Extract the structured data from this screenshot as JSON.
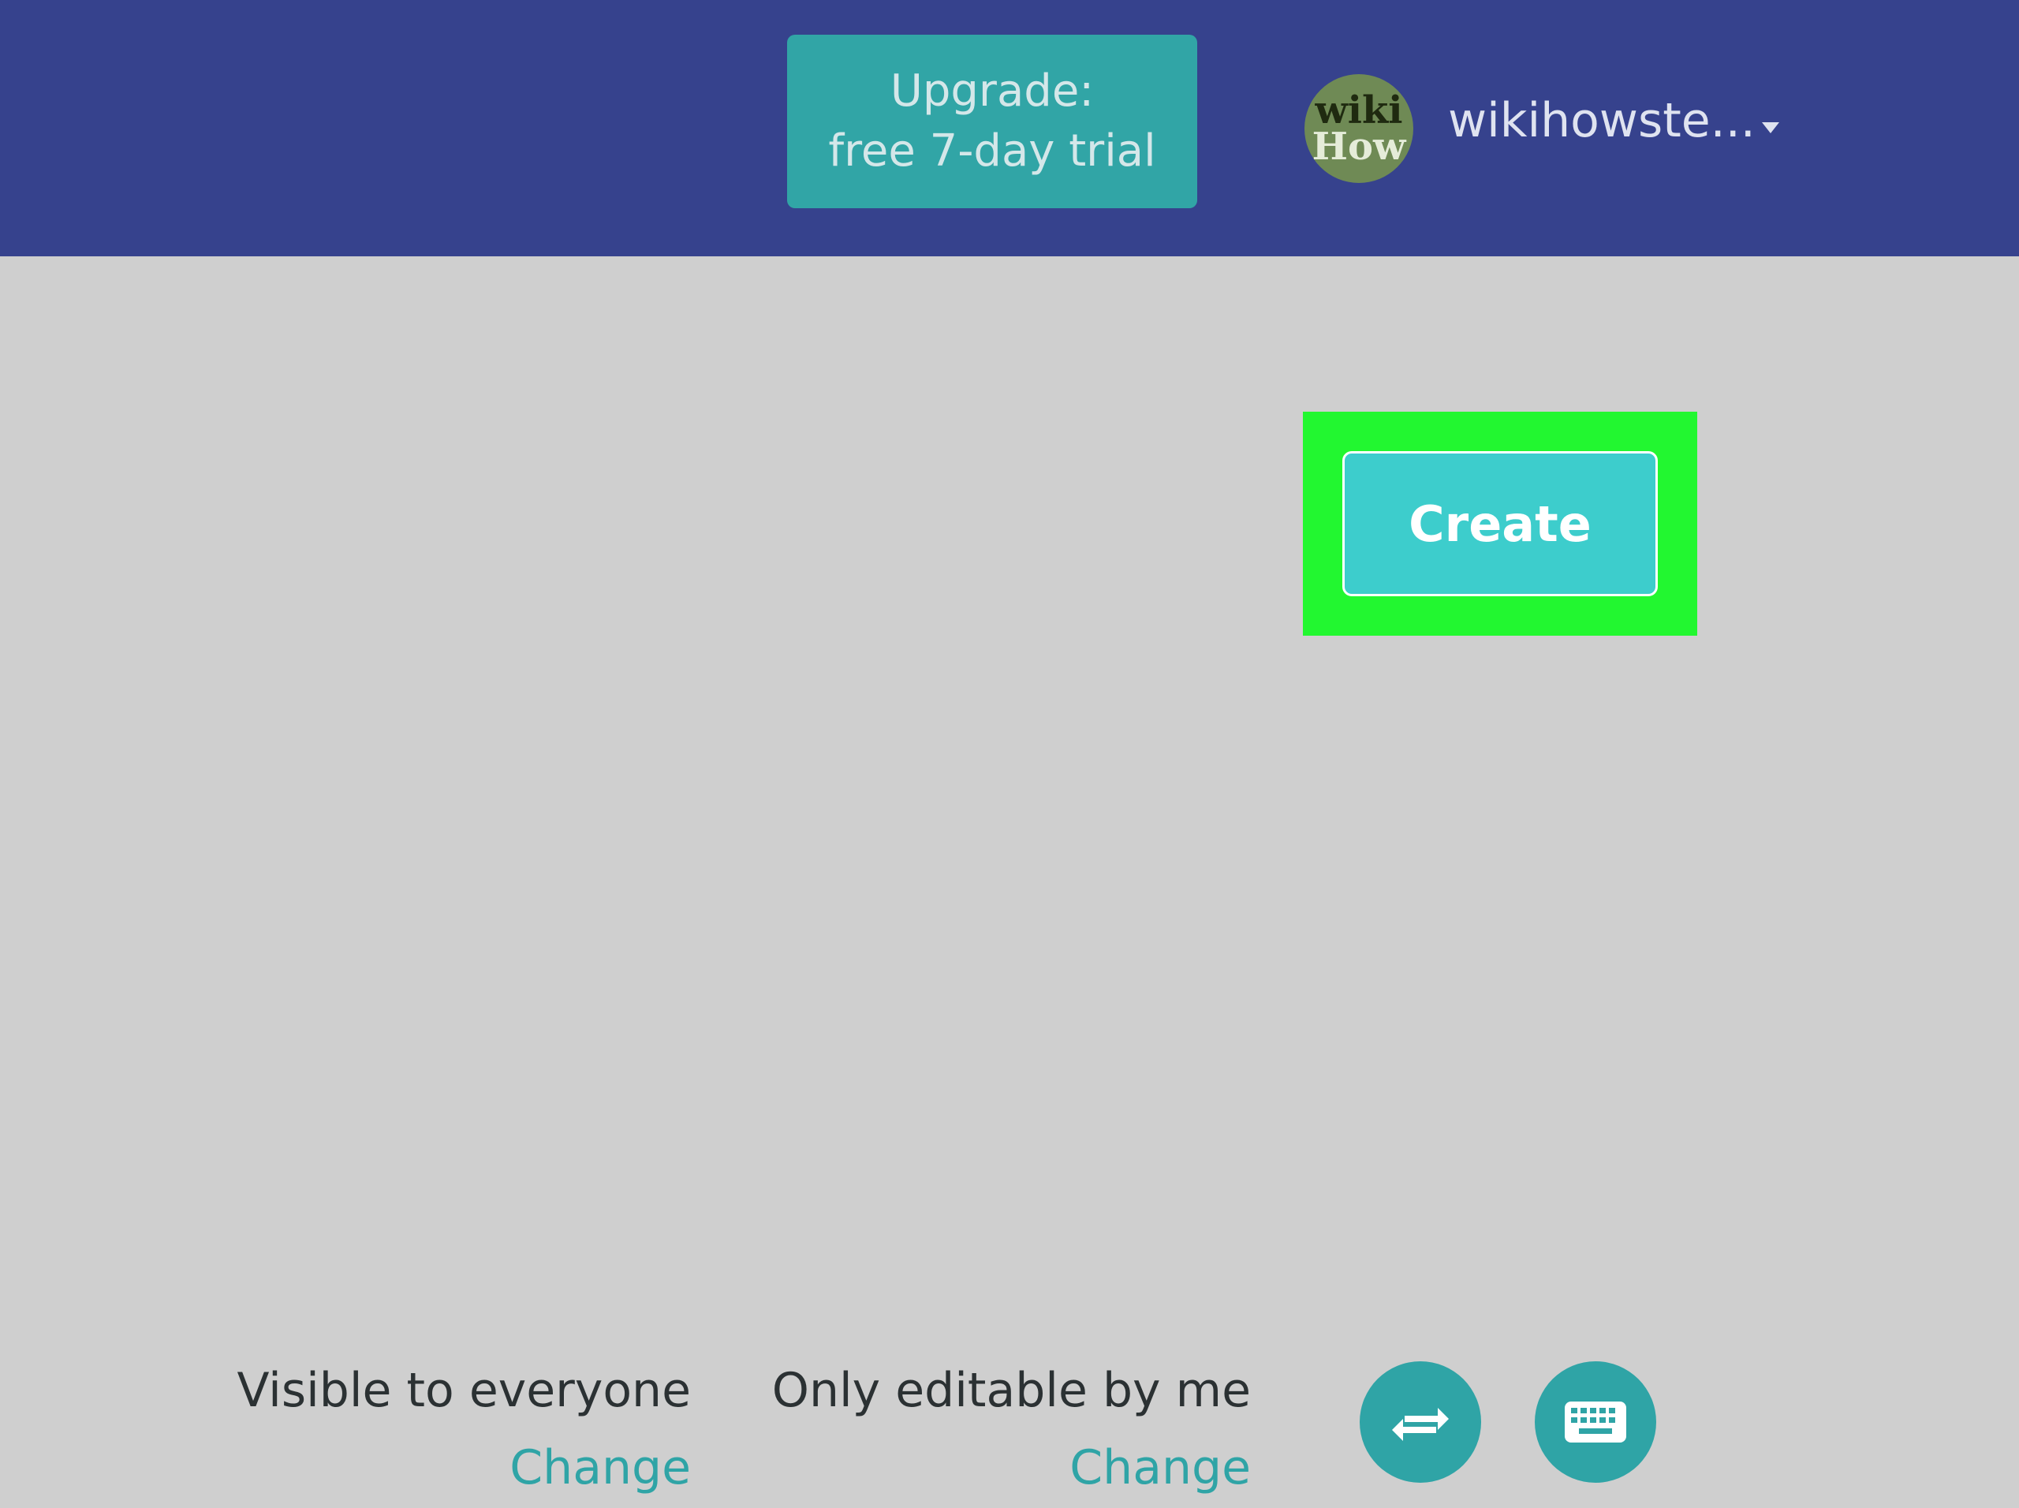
{
  "header": {
    "upgrade_line1": "Upgrade:",
    "upgrade_line2": "free 7-day trial",
    "avatar_line1": "wiki",
    "avatar_line2": "How",
    "username": "wikihowste..."
  },
  "main": {
    "create_label": "Create"
  },
  "footer": {
    "visibility_label": "Visible to everyone",
    "visibility_change": "Change",
    "editing_label": "Only editable by me",
    "editing_change": "Change"
  },
  "icons": {
    "dropdown": "chevron-down-icon",
    "swap": "swap-arrows-icon",
    "keyboard": "keyboard-icon"
  },
  "colors": {
    "header_bg": "#36428d",
    "accent_teal": "#31a5a6",
    "create_button": "#3dcdcc",
    "highlight": "#22f730",
    "page_bg": "#cfcfcf"
  }
}
